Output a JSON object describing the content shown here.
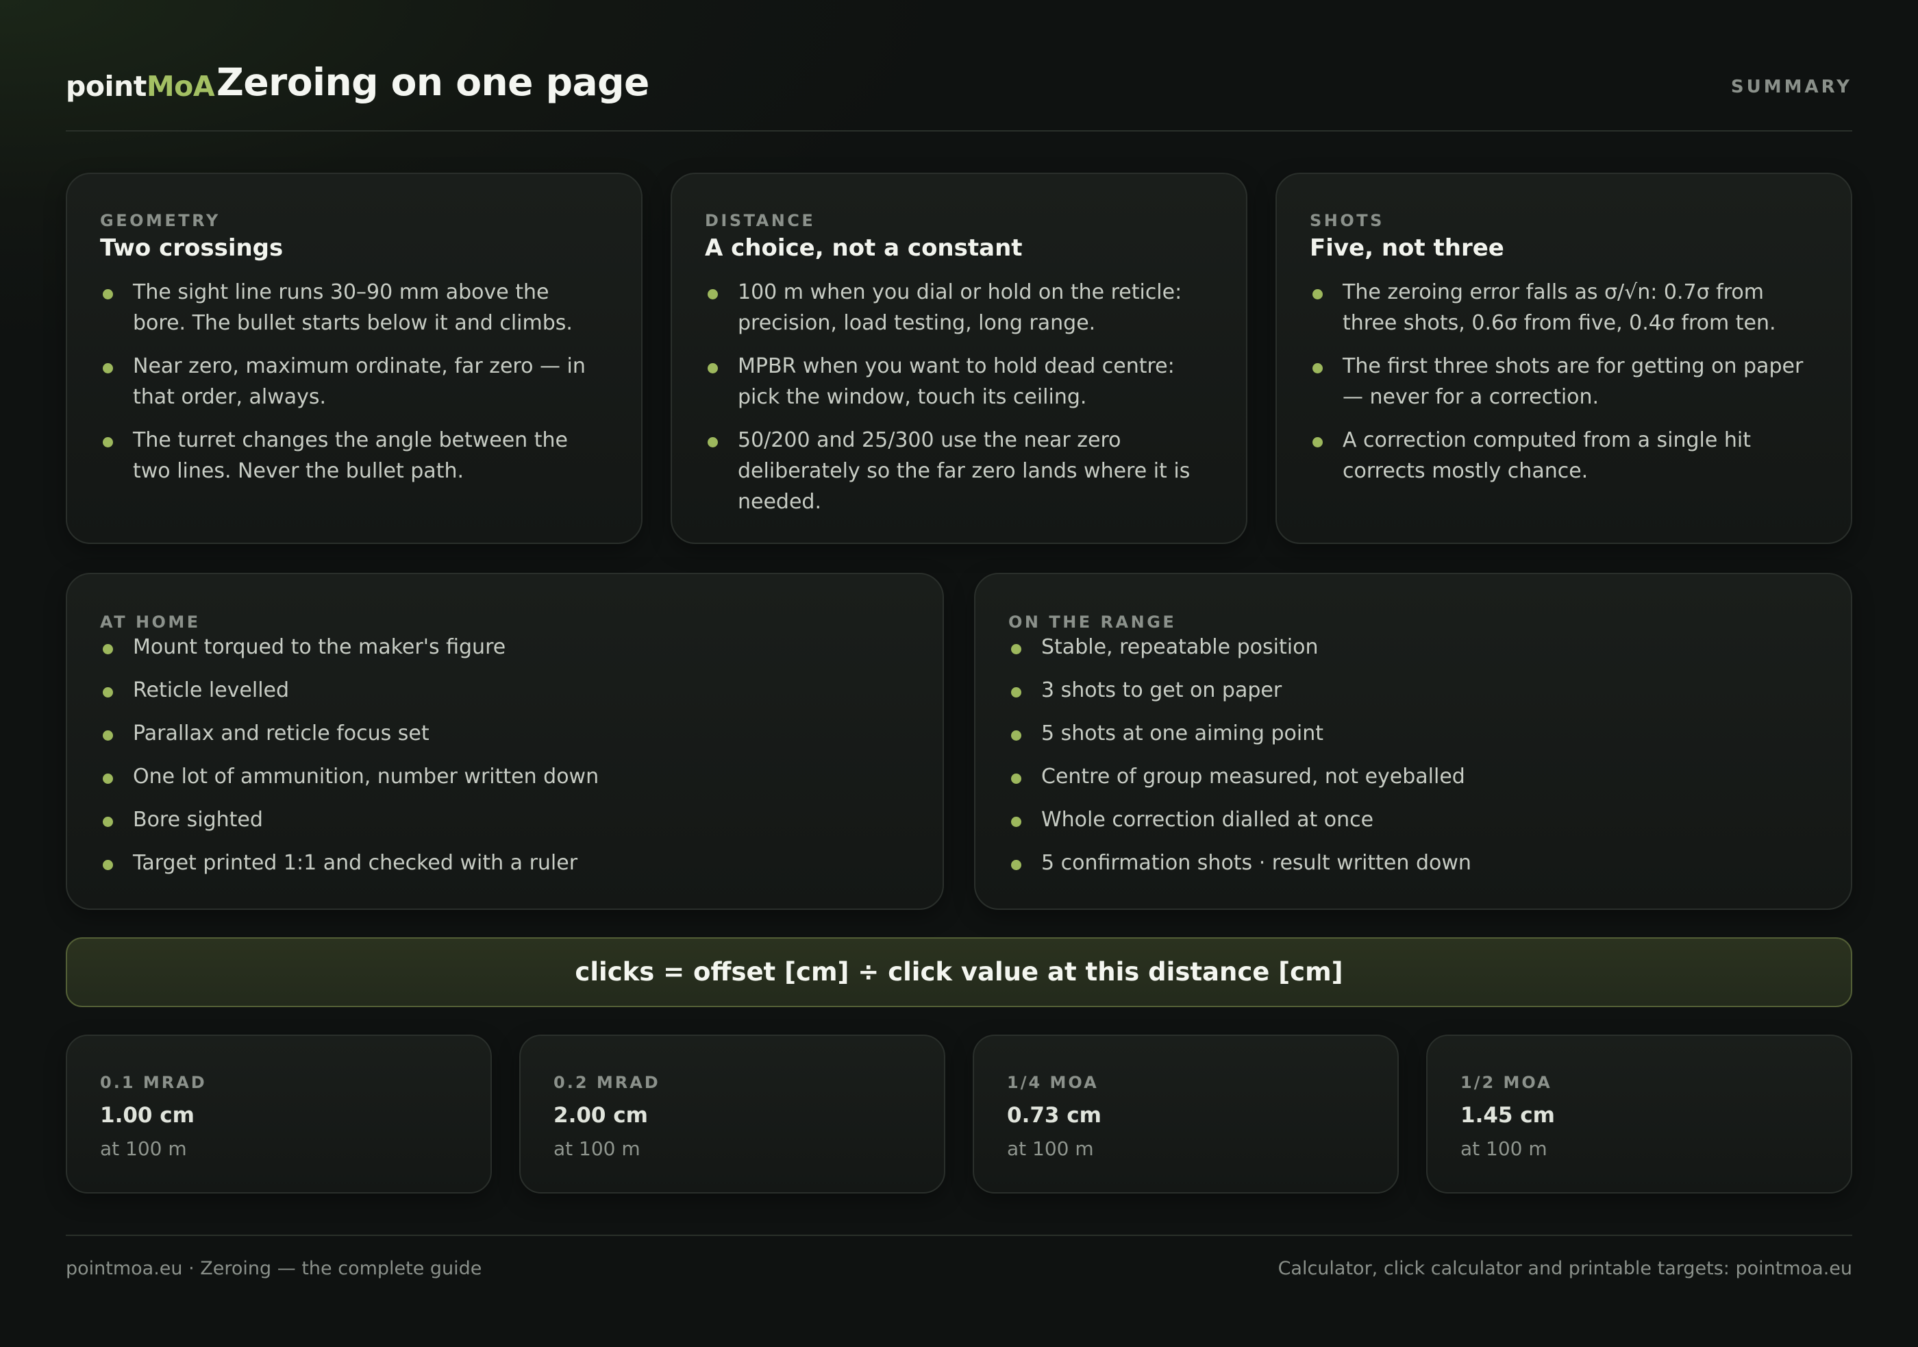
{
  "header": {
    "logo_main": "point",
    "logo_accent": "MoA",
    "title": "Zeroing on one page",
    "tag": "SUMMARY"
  },
  "cards": [
    {
      "kicker": "GEOMETRY",
      "title": "Two crossings",
      "items": [
        "The sight line runs 30–90 mm above the bore. The bullet starts below it and climbs.",
        "Near zero, maximum ordinate, far zero — in that order, always.",
        "The turret changes the angle between the two lines. Never the bullet path."
      ]
    },
    {
      "kicker": "DISTANCE",
      "title": "A choice, not a constant",
      "items": [
        "100 m when you dial or hold on the reticle: precision, load testing, long range.",
        "MPBR when you want to hold dead centre: pick the window, touch its ceiling.",
        "50/200 and 25/300 use the near zero deliberately so the far zero lands where it is needed."
      ]
    },
    {
      "kicker": "SHOTS",
      "title": "Five, not three",
      "items": [
        "The zeroing error falls as σ/√n: 0.7σ from three shots, 0.6σ from five, 0.4σ from ten.",
        "The first three shots are for getting on paper — never for a correction.",
        "A correction computed from a single hit corrects mostly chance."
      ]
    }
  ],
  "checklists": [
    {
      "kicker": "AT HOME",
      "items": [
        "Mount torqued to the maker's figure",
        "Reticle levelled",
        "Parallax and reticle focus set",
        "One lot of ammunition, number written down",
        "Bore sighted",
        "Target printed 1:1 and checked with a ruler"
      ]
    },
    {
      "kicker": "ON THE RANGE",
      "items": [
        "Stable, repeatable position",
        "3 shots to get on paper",
        "5 shots at one aiming point",
        "Centre of group measured, not eyeballed",
        "Whole correction dialled at once",
        "5 confirmation shots · result written down"
      ]
    }
  ],
  "formula": "clicks = offset [cm] ÷ click value at this distance [cm]",
  "click_values": [
    {
      "unit": "0.1 MRAD",
      "value": "1.00 cm",
      "distance": "at 100 m"
    },
    {
      "unit": "0.2 MRAD",
      "value": "2.00 cm",
      "distance": "at 100 m"
    },
    {
      "unit": "1/4 MOA",
      "value": "0.73 cm",
      "distance": "at 100 m"
    },
    {
      "unit": "1/2 MOA",
      "value": "1.45 cm",
      "distance": "at 100 m"
    }
  ],
  "footer": {
    "left": "pointmoa.eu · Zeroing — the complete guide",
    "right": "Calculator, click calculator and printable targets: pointmoa.eu"
  },
  "colors": {
    "accent": "#a3c063",
    "bullet": "#9db85d",
    "background": "#101311",
    "formula_border": "#535f36"
  }
}
